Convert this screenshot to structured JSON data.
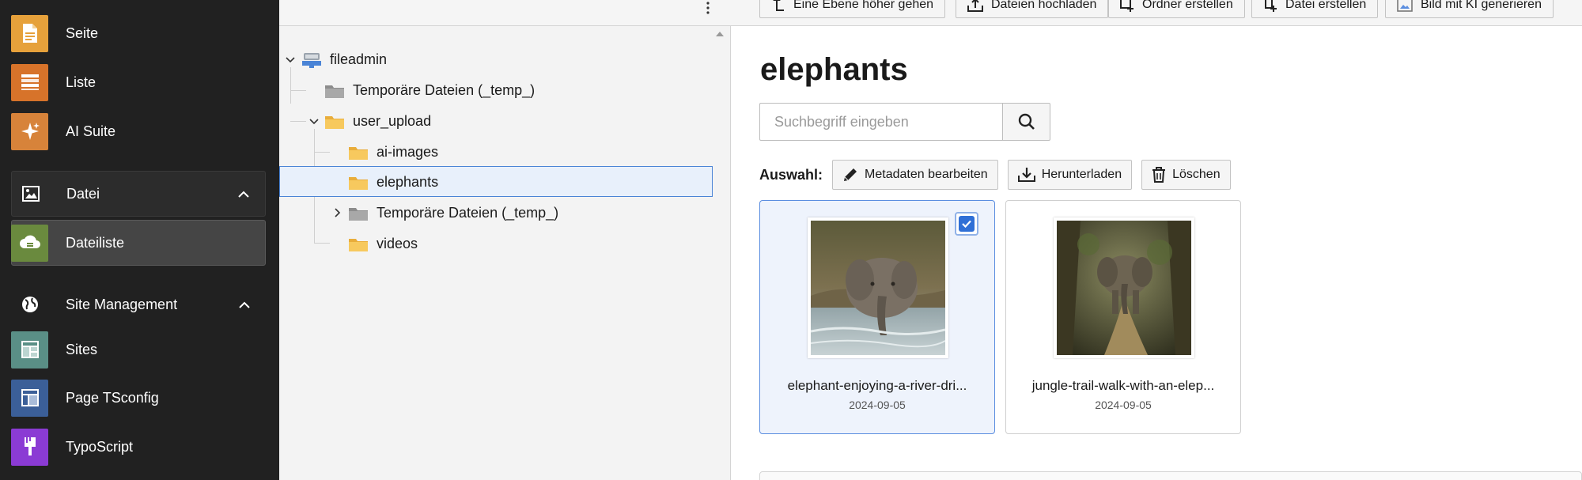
{
  "sidebar": {
    "items": [
      {
        "label": "Seite",
        "icon": "page-icon",
        "color": "#e6a13b"
      },
      {
        "label": "Liste",
        "icon": "list-icon",
        "color": "#d7732a"
      },
      {
        "label": "AI Suite",
        "icon": "sparkle-icon",
        "color": "#d7833a"
      }
    ],
    "groups": [
      {
        "label": "Datei",
        "icon": "image-icon"
      },
      {
        "label": "Site Management",
        "icon": "globe-icon"
      }
    ],
    "file_items": [
      {
        "label": "Dateiliste",
        "icon": "cloud-icon",
        "color": "#6a8a3e"
      }
    ],
    "site_items": [
      {
        "label": "Sites",
        "icon": "sites-icon",
        "color": "#5a8f86"
      },
      {
        "label": "Page TSconfig",
        "icon": "layout-icon",
        "color": "#3b5f98"
      },
      {
        "label": "TypoScript",
        "icon": "brush-icon",
        "color": "#8b3bd4"
      }
    ]
  },
  "tree": {
    "nodes": [
      {
        "label": "fileadmin"
      },
      {
        "label": "Temporäre Dateien (_temp_)"
      },
      {
        "label": "user_upload"
      },
      {
        "label": "ai-images"
      },
      {
        "label": "elephants"
      },
      {
        "label": "Temporäre Dateien (_temp_)"
      },
      {
        "label": "videos"
      }
    ]
  },
  "header": {
    "buttons": [
      {
        "label": "Eine Ebene höher gehen"
      },
      {
        "label": "Dateien hochladen"
      },
      {
        "label": "Ordner erstellen"
      },
      {
        "label": "Datei erstellen"
      },
      {
        "label": "Bild mit KI generieren"
      }
    ]
  },
  "main": {
    "title": "elephants",
    "search": {
      "placeholder": "Suchbegriff eingeben",
      "value": ""
    },
    "selection": {
      "label": "Auswahl:",
      "buttons": [
        {
          "label": "Metadaten bearbeiten"
        },
        {
          "label": "Herunterladen"
        },
        {
          "label": "Löschen"
        }
      ]
    },
    "files": [
      {
        "name": "elephant-enjoying-a-river-dri...",
        "date": "2024-09-05",
        "selected": true
      },
      {
        "name": "jungle-trail-walk-with-an-elep...",
        "date": "2024-09-05",
        "selected": false
      }
    ]
  },
  "colors": {
    "sidebar_bg": "#212121",
    "accent": "#2f6fd6",
    "folder": "#f5c35b"
  }
}
